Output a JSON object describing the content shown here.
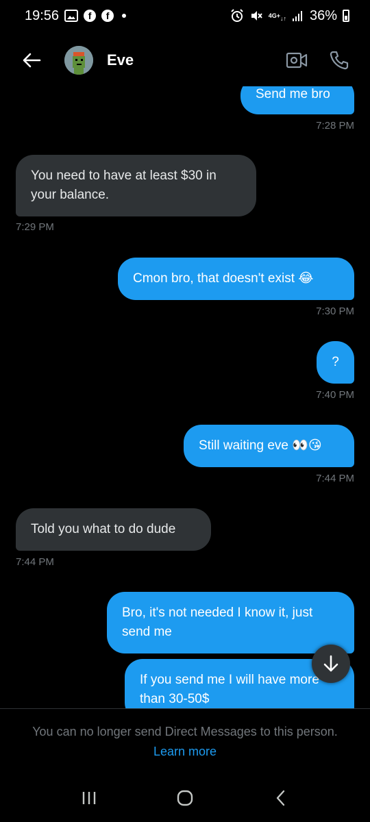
{
  "status_bar": {
    "time": "19:56",
    "battery": "36%",
    "network": "4G+",
    "left_icons": [
      "gallery-icon",
      "facebook-icon",
      "facebook-icon",
      "dot-icon"
    ],
    "right_icons": [
      "alarm-icon",
      "mute-icon",
      "network-icon",
      "signal-icon",
      "battery-icon"
    ]
  },
  "header": {
    "contact_name": "Eve",
    "back_icon": "arrow-left-icon",
    "video_icon": "video-call-icon",
    "call_icon": "phone-icon"
  },
  "messages": [
    {
      "direction": "out",
      "text": "Send me bro",
      "time": "7:28 PM"
    },
    {
      "direction": "in",
      "text": "You need to have at least $30 in your balance.",
      "time": "7:29 PM"
    },
    {
      "direction": "out",
      "text": "Cmon bro, that doesn't exist",
      "emoji": "😂",
      "time": "7:30 PM"
    },
    {
      "direction": "out",
      "text": "?",
      "time": "7:40 PM"
    },
    {
      "direction": "out",
      "text": "Still waiting eve",
      "emoji": "👀😘",
      "time": "7:44 PM"
    },
    {
      "direction": "in",
      "text": "Told you what to do dude",
      "time": "7:44 PM"
    },
    {
      "direction": "out",
      "text": "Bro, it's not needed I know it, just send me",
      "time": ""
    },
    {
      "direction": "out",
      "text": "If you send me I will have more than 30-50$",
      "time": ""
    }
  ],
  "scroll_button_icon": "arrow-down-icon",
  "footer": {
    "notice": "You can no longer send Direct Messages to this person.",
    "link": "Learn more"
  },
  "nav_bar": {
    "recent_icon": "recent-apps-icon",
    "home_icon": "home-icon",
    "back_icon": "back-icon"
  },
  "colors": {
    "background": "#000000",
    "outgoing_bubble": "#1d9bf0",
    "incoming_bubble": "#2f3336",
    "timestamp": "#71767b",
    "link": "#1d9bf0"
  }
}
